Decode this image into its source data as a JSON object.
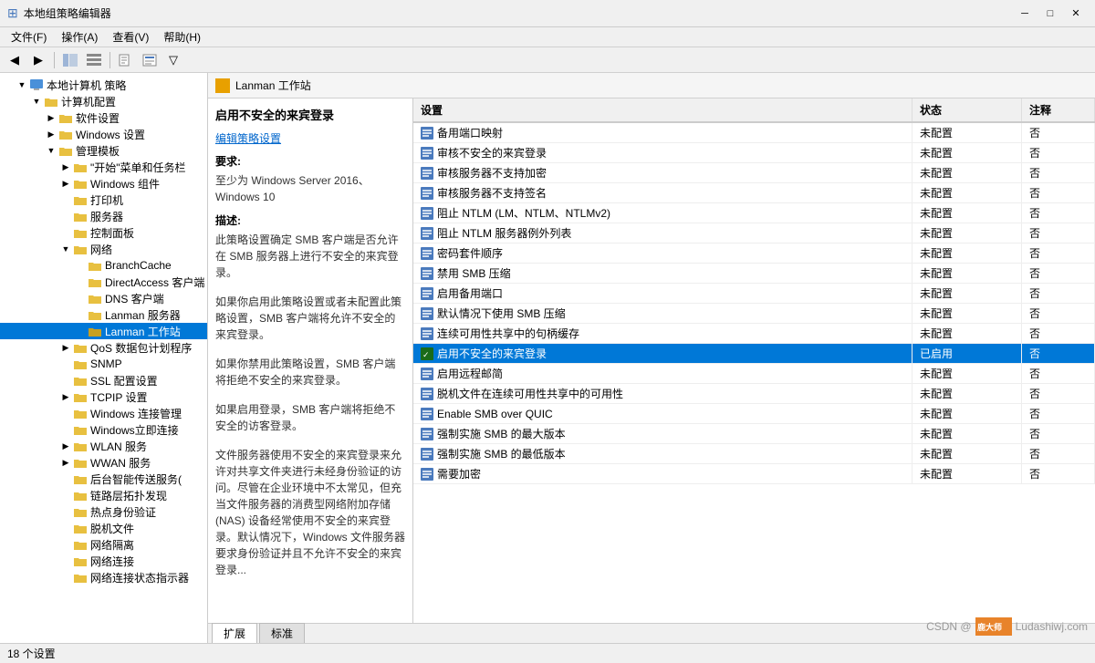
{
  "titleBar": {
    "title": "本地组策略编辑器",
    "minimize": "─",
    "maximize": "□",
    "close": "✕"
  },
  "menuBar": {
    "items": [
      {
        "label": "文件(F)"
      },
      {
        "label": "操作(A)"
      },
      {
        "label": "查看(V)"
      },
      {
        "label": "帮助(H)"
      }
    ]
  },
  "toolbar": {
    "buttons": [
      "←",
      "→",
      "↑",
      "✕",
      "⬛",
      "🖹",
      "📋",
      "▼",
      "⚙"
    ]
  },
  "treePanel": {
    "rootLabel": "本地计算机 策略",
    "items": [
      {
        "id": "computer-config",
        "label": "计算机配置",
        "level": 1,
        "expanded": true,
        "hasChildren": true
      },
      {
        "id": "software-settings",
        "label": "软件设置",
        "level": 2,
        "expanded": false,
        "hasChildren": true
      },
      {
        "id": "windows-settings",
        "label": "Windows 设置",
        "level": 2,
        "expanded": false,
        "hasChildren": true
      },
      {
        "id": "admin-templates",
        "label": "管理模板",
        "level": 2,
        "expanded": true,
        "hasChildren": true
      },
      {
        "id": "start-taskbar",
        "label": "\"开始\"菜单和任务栏",
        "level": 3,
        "expanded": false,
        "hasChildren": true
      },
      {
        "id": "windows-components",
        "label": "Windows 组件",
        "level": 3,
        "expanded": false,
        "hasChildren": true
      },
      {
        "id": "printer",
        "label": "打印机",
        "level": 3,
        "expanded": false,
        "hasChildren": false
      },
      {
        "id": "server",
        "label": "服务器",
        "level": 3,
        "expanded": false,
        "hasChildren": false
      },
      {
        "id": "control-panel",
        "label": "控制面板",
        "level": 3,
        "expanded": false,
        "hasChildren": false
      },
      {
        "id": "network",
        "label": "网络",
        "level": 3,
        "expanded": true,
        "hasChildren": true
      },
      {
        "id": "branchcache",
        "label": "BranchCache",
        "level": 4,
        "expanded": false,
        "hasChildren": false
      },
      {
        "id": "directaccess",
        "label": "DirectAccess 客户端",
        "level": 4,
        "expanded": false,
        "hasChildren": false
      },
      {
        "id": "dns-client",
        "label": "DNS 客户端",
        "level": 4,
        "expanded": false,
        "hasChildren": false
      },
      {
        "id": "lanman-server",
        "label": "Lanman 服务器",
        "level": 4,
        "expanded": false,
        "hasChildren": false
      },
      {
        "id": "lanman-workstation",
        "label": "Lanman 工作站",
        "level": 4,
        "expanded": false,
        "hasChildren": false,
        "selected": true
      },
      {
        "id": "qos",
        "label": "QoS 数据包计划程序",
        "level": 3,
        "expanded": false,
        "hasChildren": true
      },
      {
        "id": "snmp",
        "label": "SNMP",
        "level": 3,
        "expanded": false,
        "hasChildren": false
      },
      {
        "id": "ssl-config",
        "label": "SSL 配置设置",
        "level": 3,
        "expanded": false,
        "hasChildren": false
      },
      {
        "id": "tcpip",
        "label": "TCPIP 设置",
        "level": 3,
        "expanded": false,
        "hasChildren": true
      },
      {
        "id": "windows-connection",
        "label": "Windows 连接管理",
        "level": 3,
        "expanded": false,
        "hasChildren": false
      },
      {
        "id": "windows-instant",
        "label": "Windows立即连接",
        "level": 3,
        "expanded": false,
        "hasChildren": false
      },
      {
        "id": "wlan",
        "label": "WLAN 服务",
        "level": 3,
        "expanded": false,
        "hasChildren": true
      },
      {
        "id": "wwan",
        "label": "WWAN 服务",
        "level": 3,
        "expanded": false,
        "hasChildren": true
      },
      {
        "id": "bg-transfer",
        "label": "后台智能传送服务(",
        "level": 3,
        "expanded": false,
        "hasChildren": false
      },
      {
        "id": "link-layer",
        "label": "链路层拓扑发现",
        "level": 3,
        "expanded": false,
        "hasChildren": false
      },
      {
        "id": "hotspot",
        "label": "热点身份验证",
        "level": 3,
        "expanded": false,
        "hasChildren": false
      },
      {
        "id": "offline-files",
        "label": "脱机文件",
        "level": 3,
        "expanded": false,
        "hasChildren": false
      },
      {
        "id": "network-isolation",
        "label": "网络隔离",
        "level": 3,
        "expanded": false,
        "hasChildren": false
      },
      {
        "id": "network-connection",
        "label": "网络连接",
        "level": 3,
        "expanded": false,
        "hasChildren": false
      },
      {
        "id": "network-connection-status",
        "label": "网络连接状态指示器",
        "level": 3,
        "expanded": false,
        "hasChildren": false
      }
    ]
  },
  "breadcrumb": {
    "label": "Lanman 工作站"
  },
  "descPanel": {
    "title": "启用不安全的来宾登录",
    "linkText": "编辑策略设置",
    "sections": [
      {
        "title": "要求:",
        "text": "至少为 Windows Server 2016、Windows 10"
      },
      {
        "title": "描述:",
        "text": "此策略设置确定 SMB 客户端是否允许在 SMB 服务器上进行不安全的来宾登录。\n\n如果你启用此策略设置或者未配置此策略设置，SMB 客户端将允许不安全的来宾登录。\n\n如果你禁用此策略设置，SMB 客户端将拒绝不安全的来宾登录。\n\n如果启用登录，SMB 客户端将拒绝不安全的访客登录。\n\n文件服务器使用不安全的来宾登录来允许对共享文件夹进行未经身份验证的访问。尽管在企业环境中不太常见，但充当文件服务器的消费型网络附加存储 (NAS) 设备经常使用不安全的来宾登录。默认情况下，Windows 文件服务器要求身份验证并且不允许不安全的来宾登录..."
      }
    ]
  },
  "settingsTable": {
    "headers": [
      "设置",
      "状态",
      "注释"
    ],
    "rows": [
      {
        "name": "备用端口映射",
        "status": "未配置",
        "note": "否",
        "enabled": false
      },
      {
        "name": "审核不安全的来宾登录",
        "status": "未配置",
        "note": "否",
        "enabled": false
      },
      {
        "name": "审核服务器不支持加密",
        "status": "未配置",
        "note": "否",
        "enabled": false
      },
      {
        "name": "审核服务器不支持签名",
        "status": "未配置",
        "note": "否",
        "enabled": false
      },
      {
        "name": "阻止 NTLM (LM、NTLM、NTLMv2)",
        "status": "未配置",
        "note": "否",
        "enabled": false
      },
      {
        "name": "阻止 NTLM 服务器例外列表",
        "status": "未配置",
        "note": "否",
        "enabled": false
      },
      {
        "name": "密码套件顺序",
        "status": "未配置",
        "note": "否",
        "enabled": false
      },
      {
        "name": "禁用 SMB 压缩",
        "status": "未配置",
        "note": "否",
        "enabled": false
      },
      {
        "name": "启用备用端口",
        "status": "未配置",
        "note": "否",
        "enabled": false
      },
      {
        "name": "默认情况下使用 SMB 压缩",
        "status": "未配置",
        "note": "否",
        "enabled": false
      },
      {
        "name": "连续可用性共享中的句柄缓存",
        "status": "未配置",
        "note": "否",
        "enabled": false
      },
      {
        "name": "启用不安全的来宾登录",
        "status": "已启用",
        "note": "否",
        "enabled": true,
        "selected": true
      },
      {
        "name": "启用远程邮简",
        "status": "未配置",
        "note": "否",
        "enabled": false
      },
      {
        "name": "脱机文件在连续可用性共享中的可用性",
        "status": "未配置",
        "note": "否",
        "enabled": false
      },
      {
        "name": "Enable SMB over QUIC",
        "status": "未配置",
        "note": "否",
        "enabled": false
      },
      {
        "name": "强制实施 SMB 的最大版本",
        "status": "未配置",
        "note": "否",
        "enabled": false
      },
      {
        "name": "强制实施 SMB 的最低版本",
        "status": "未配置",
        "note": "否",
        "enabled": false
      },
      {
        "name": "需要加密",
        "status": "未配置",
        "note": "否",
        "enabled": false
      }
    ]
  },
  "tabs": [
    {
      "label": "扩展",
      "active": true
    },
    {
      "label": "标准",
      "active": false
    }
  ],
  "statusBar": {
    "text": "18 个设置"
  },
  "watermark": {
    "csdn": "CSDN @",
    "logo": "鹿大师",
    "site": "Ludashiwj.com"
  }
}
